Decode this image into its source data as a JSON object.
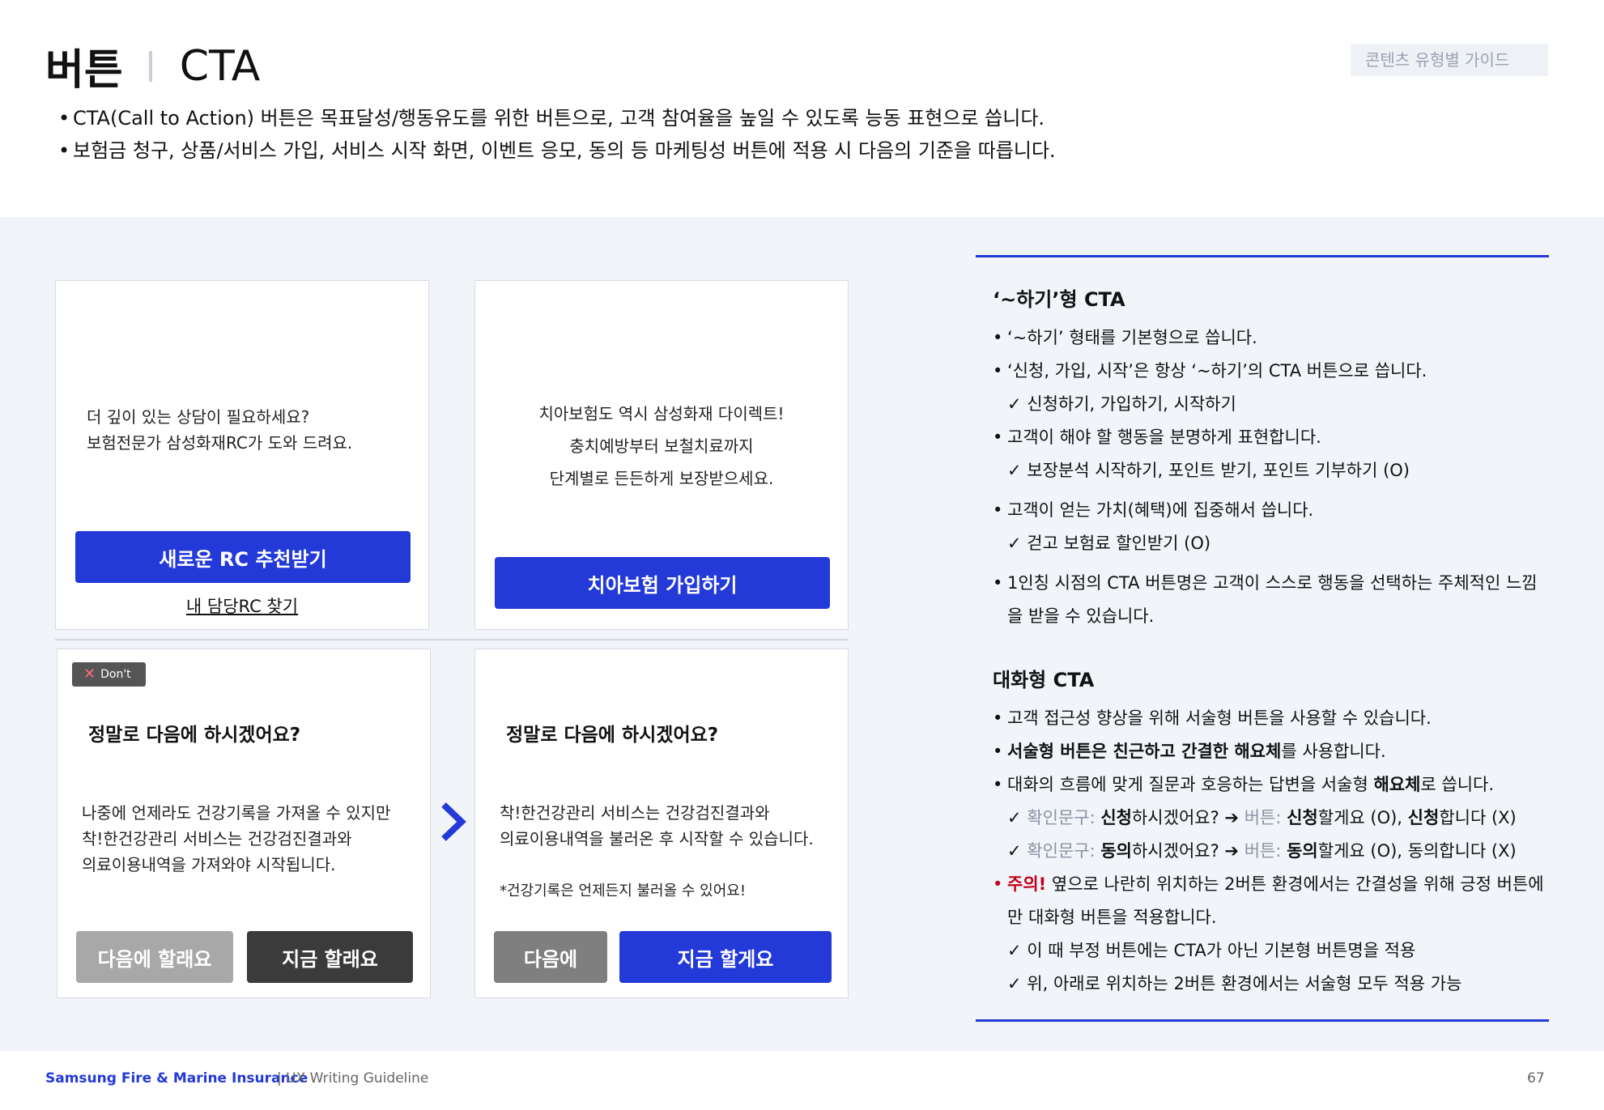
{
  "header": {
    "title_ko": "버튼",
    "title_en": "CTA",
    "guide_tag": "콘텐츠 유형별 가이드",
    "intro": [
      "CTA(Call to Action) 버튼은 목표달성/행동유도를 위한 버튼으로, 고객 참여율을 높일 수 있도록 능동 표현으로 씁니다.",
      "보험금 청구, 상품/서비스 가입, 서비스 시작 화면, 이벤트 응모, 동의 등 마케팅성 버튼에 적용 시 다음의 기준을 따릅니다."
    ]
  },
  "cards": {
    "card1": {
      "line1": "더 깊이 있는 상담이 필요하세요?",
      "line2": "보험전문가 삼성화재RC가 도와 드려요.",
      "button": "새로운 RC 추천받기",
      "link": "내 담당RC 찾기"
    },
    "card2": {
      "line1": "치아보험도 역시 삼성화재 다이렉트!",
      "line2": "충치예방부터 보철치료까지",
      "line3": "단계별로 든든하게 보장받으세요.",
      "button": "치아보험 가입하기"
    },
    "card3": {
      "badge": "Don't",
      "heading": "정말로 다음에 하시겠어요?",
      "line1": "나중에 언제라도 건강기록을 가져올 수 있지만",
      "line2": "착!한건강관리 서비스는 건강검진결과와",
      "line3": "의료이용내역을 가져와야 시작됩니다.",
      "button_left": "다음에 할래요",
      "button_right": "지금 할래요"
    },
    "card4": {
      "heading": "정말로 다음에 하시겠어요?",
      "line1": "착!한건강관리 서비스는 건강검진결과와",
      "line2": "의료이용내역을 불러온 후 시작할 수 있습니다.",
      "note": "*건강기록은 언제든지 불러올 수 있어요!",
      "button_left": "다음에",
      "button_right": "지금 할게요"
    }
  },
  "side": {
    "section1": {
      "heading": "‘~하기’형 CTA",
      "b1": "‘~하기’ 형태를 기본형으로 씁니다.",
      "b2": "‘신청, 가입, 시작’은 항상 ‘~하기’의 CTA 버튼으로 씁니다.",
      "c1": "✓ 신청하기, 가입하기, 시작하기",
      "b3": "고객이 해야 할 행동을 분명하게 표현합니다.",
      "c2": "✓ 보장분석 시작하기, 포인트 받기, 포인트 기부하기 (O)",
      "b4": "고객이 얻는 가치(혜택)에 집중해서 씁니다.",
      "c3": "✓ 걷고 보험료 할인받기 (O)",
      "b5a": "1인칭 시점의 CTA 버튼명은 고객이 스스로 행동을 선택하는 주체적인 느낌",
      "b5b": "을 받을 수 있습니다."
    },
    "section2": {
      "heading": "대화형 CTA",
      "b1": "고객 접근성 향상을 위해 서술형 버튼을 사용할 수 있습니다.",
      "b2_bold1": "서술형 버튼은 친근하고 간결한 해요체",
      "b2_rest": "를 사용합니다.",
      "b3_pre": "대화의 흐름에 맞게 질문과 호응하는 답변을 서술형 ",
      "b3_bold": "해요체",
      "b3_post": "로 씁니다.",
      "c1_check": "✓",
      "c1_grey1": "확인문구:",
      "c1_bold1": "신청",
      "c1_t1": "하시겠어요? ➔",
      "c1_grey2": "버튼:",
      "c1_bold2": "신청",
      "c1_t2": "할게요 (O),",
      "c1_bold3": "신청",
      "c1_t3": "합니다 (X)",
      "c2_grey1": "확인문구:",
      "c2_bold1": "동의",
      "c2_t1": "하시겠어요? ➔",
      "c2_grey2": "버튼:",
      "c2_bold2": "동의",
      "c2_t2": "할게요 (O), 동의합니다 (X)",
      "b4_red": "주의!",
      "b4a": "옆으로 나란히 위치하는 2버튼 환경에서는 간결성을 위해 긍정 버튼에",
      "b4b": "만 대화형 버튼을 적용합니다.",
      "c3": "✓ 이 때 부정 버튼에는 CTA가 아닌 기본형 버튼명을 적용",
      "c4": "✓ 위, 아래로 위치하는 2버튼 환경에서는 서술형 모두 적용 가능"
    }
  },
  "footer": {
    "brand": "Samsung Fire & Marine Insurance",
    "brand_sub": "|  UX Writing Guideline",
    "page": "67"
  },
  "colors": {
    "accent": "#2339d8",
    "panel_bg": "#f1f4f9",
    "warning_red": "#c4001a"
  }
}
